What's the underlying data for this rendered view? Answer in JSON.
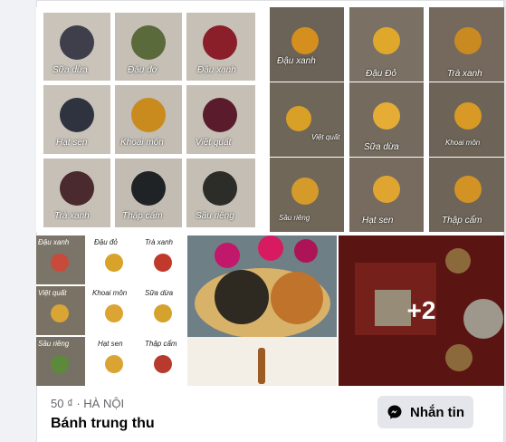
{
  "listing": {
    "price_location": "50 ₫ · HÀ NỘI",
    "title": "Bánh trung thu",
    "message_button_label": "Nhắn tin",
    "more_photos_overlay": "+2"
  },
  "photo_1_labels": [
    "Sữa dừa",
    "Đậu đơ",
    "Đậu xanh",
    "Hạt sen",
    "Khoai môn",
    "Việt quất",
    "Trà xanh",
    "Thập cẩm",
    "Sầu riêng"
  ],
  "photo_2_labels": [
    "Đậu xanh",
    "Đậu Đỏ",
    "Trà xanh",
    "Việt quất",
    "Sữa dừa",
    "Khoai môn",
    "Sầu riêng",
    "Hạt sen",
    "Thập cẩm"
  ],
  "photo_3_labels": [
    "Đậu xanh",
    "Đậu đỏ",
    "Trà xanh",
    "Việt quất",
    "Khoai môn",
    "Sữa dừa",
    "Sầu riêng",
    "Hạt sen",
    "Thập cẩm"
  ],
  "icons": {
    "messenger": "messenger-icon"
  },
  "colors": {
    "button_bg": "#e4e6eb",
    "meta_text": "#65676b"
  }
}
